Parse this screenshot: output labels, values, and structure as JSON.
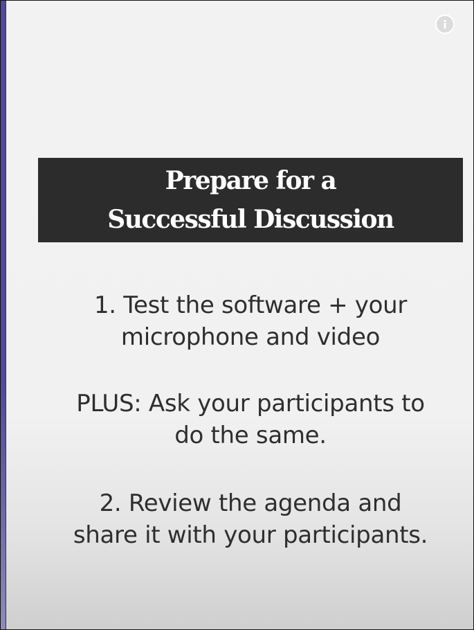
{
  "info_button": {
    "icon": "info-icon",
    "glyph": "i"
  },
  "colors": {
    "accent_bar": "#4f4a99",
    "title_band": "#2c2c2c",
    "title_text": "#ffffff",
    "body_text": "#2e2e2e"
  },
  "slide": {
    "title_lines": [
      "Prepare for a",
      "Successful Discussion"
    ],
    "item1_lines": [
      "1. Test the software + your",
      "microphone and video"
    ],
    "plus_lines": [
      "PLUS: Ask your participants to",
      "do the same."
    ],
    "item2_lines": [
      "2. Review the agenda and",
      "share it with your participants."
    ]
  }
}
